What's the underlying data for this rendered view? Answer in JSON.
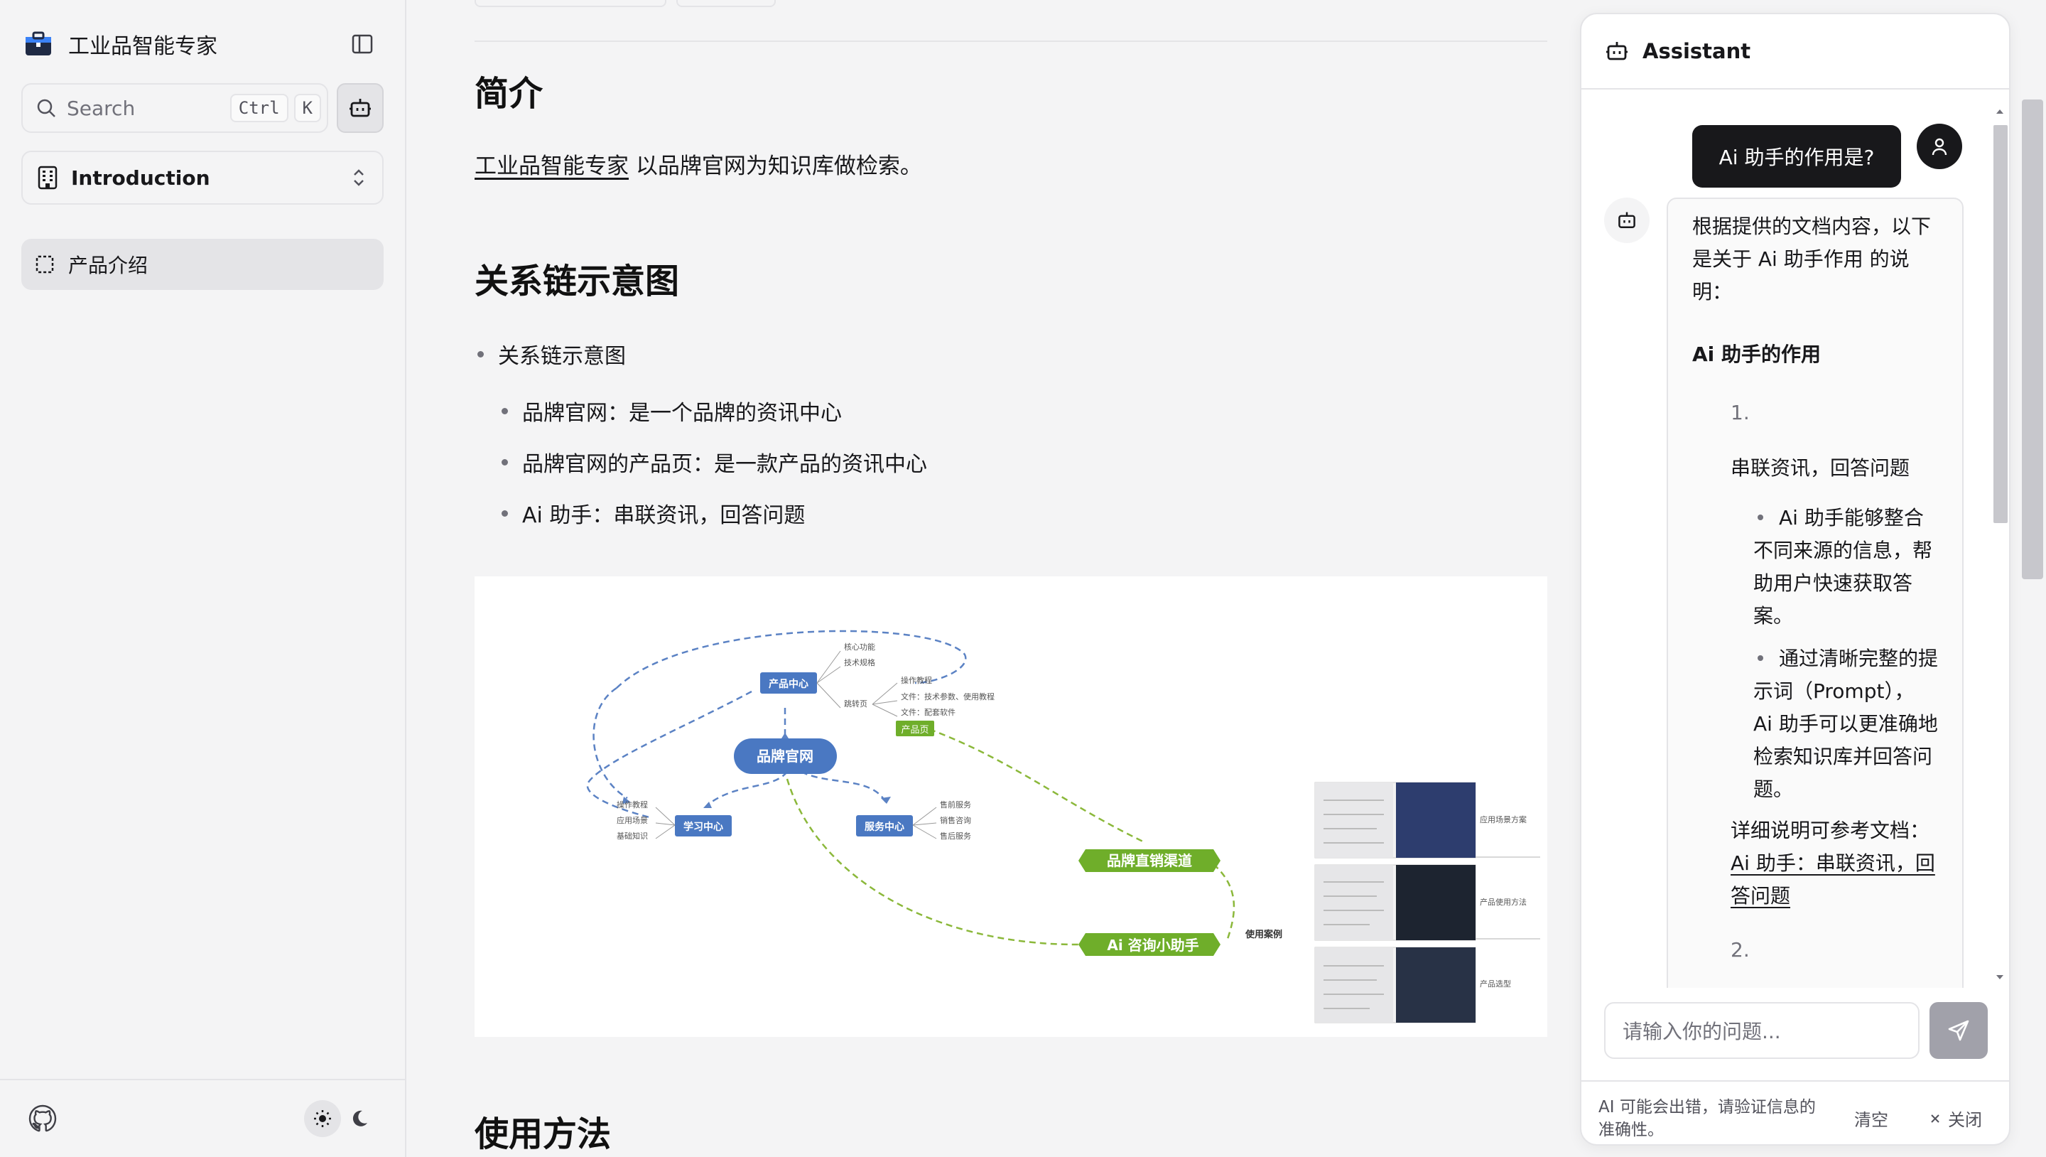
{
  "sidebar": {
    "brand_name": "工业品智能专家",
    "search_placeholder": "Search",
    "kbd_ctrl": "Ctrl",
    "kbd_k": "K",
    "select_label": "Introduction",
    "nav_items": [
      {
        "label": "产品介绍"
      }
    ]
  },
  "main": {
    "h_intro": "简介",
    "intro_link": "工业品智能专家",
    "intro_rest": " 以品牌官网为知识库做检索。",
    "h_relation": "关系链示意图",
    "bullet_top": "关系链示意图",
    "bullets": [
      "品牌官网：是一个品牌的资讯中心",
      "品牌官网的产品页：是一款产品的资讯中心",
      "Ai 助手：串联资讯，回答问题"
    ],
    "h_usage": "使用方法",
    "mindmap": {
      "center": "品牌官网",
      "product_center": "产品中心",
      "learn_center": "学习中心",
      "service_center": "服务中心",
      "product_page": "产品页",
      "channel": "品牌直销渠道",
      "assistant": "Ai 咨询小助手",
      "use_case": "使用案例",
      "pc_items": [
        "核心功能",
        "技术规格",
        "跳转页"
      ],
      "jump_items": [
        "操作教程",
        "文件：技术参数、使用教程",
        "文件：配套软件"
      ],
      "learn_items": [
        "操作教程",
        "应用场景",
        "基础知识"
      ],
      "service_items": [
        "售前服务",
        "销售咨询",
        "售后服务"
      ],
      "case_items": [
        "应用场景方案",
        "产品使用方法",
        "产品选型"
      ]
    }
  },
  "assistant": {
    "title": "Assistant",
    "user_msg": "Ai 助手的作用是?",
    "reply_intro_lines": [
      "根据提供的文档内容，以下",
      "是关于 Ai 助手作用 的说",
      "明："
    ],
    "reply_heading": "Ai 助手的作用",
    "num1": "1.",
    "sub_heading": "串联资讯，回答问题",
    "sub_bullet1_lines": [
      "Ai 助手能够整合",
      "不同来源的信息，帮",
      "助用户快速获取答",
      "案。"
    ],
    "sub_bullet2_lines": [
      "通过清晰完整的提",
      "示词（Prompt），",
      "Ai 助手可以更准确地",
      "检索知识库并回答问",
      "题。"
    ],
    "ref_text": "详细说明可参考文档：",
    "ref_link_lines": [
      "Ai 助手：串联资讯，回",
      "答问题"
    ],
    "num2": "2.",
    "input_placeholder": "请输入你的问题...",
    "disclaimer_lines": [
      "AI 可能会出错，请验证信息的",
      "准确性。"
    ],
    "clear_label": "清空",
    "close_label": "关闭"
  }
}
